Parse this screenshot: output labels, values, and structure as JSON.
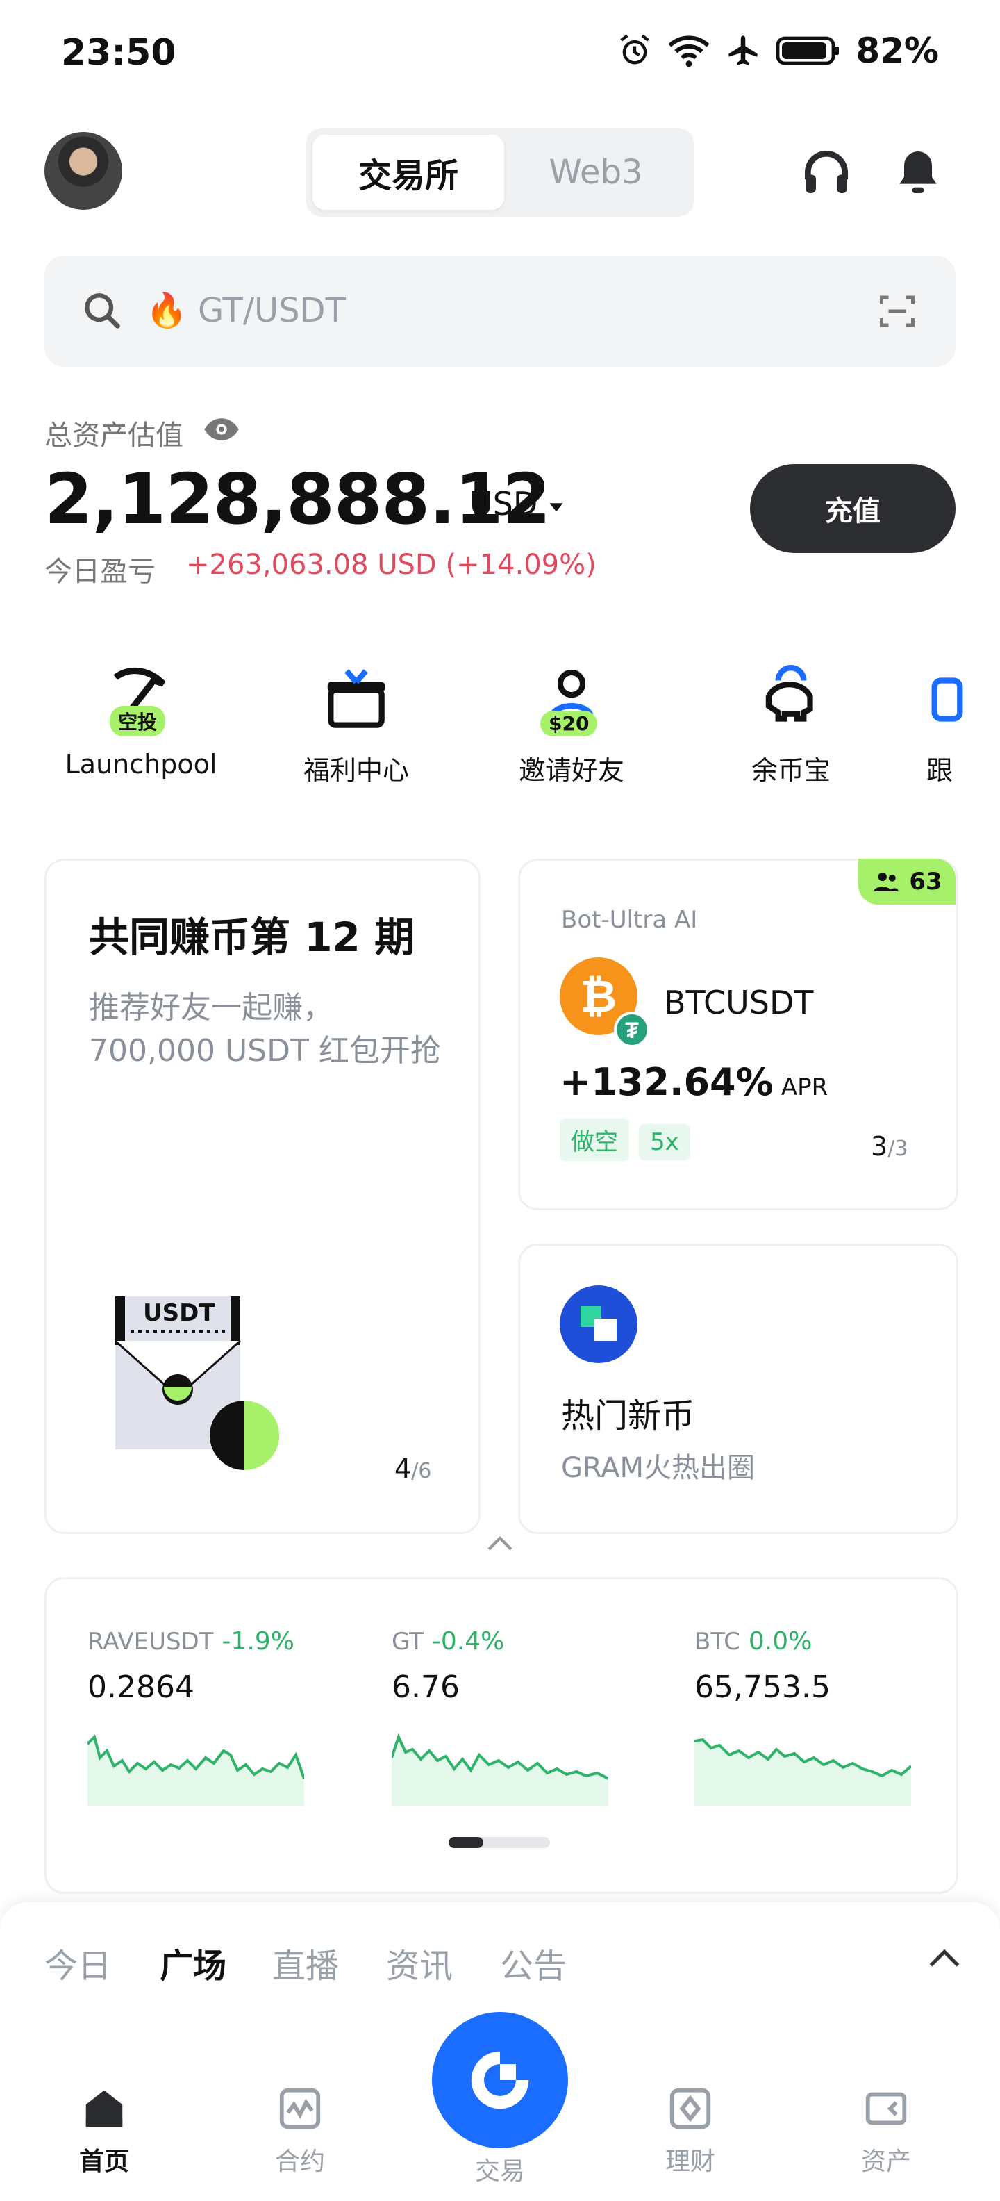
{
  "status_bar": {
    "time": "23:50",
    "battery": "82%"
  },
  "header": {
    "tabs": [
      {
        "label": "交易所",
        "active": true
      },
      {
        "label": "Web3",
        "active": false
      }
    ],
    "icons": [
      "headset-icon",
      "bell-icon"
    ]
  },
  "search": {
    "placeholder": "🔥 GT/USDT"
  },
  "totals": {
    "label": "总资产估值",
    "value": "2,128,888.12",
    "currency": "USD",
    "pnl_label": "今日盈亏",
    "pnl_value": "+263,063.08 USD",
    "pnl_percent": "(+14.09%)",
    "deposit_label": "充值"
  },
  "quick_actions": [
    {
      "label": "Launchpool",
      "badge": "空投"
    },
    {
      "label": "福利中心"
    },
    {
      "label": "邀请好友",
      "badge": "$20"
    },
    {
      "label": "余币宝"
    },
    {
      "label": "跟"
    }
  ],
  "promo_card": {
    "title": "共同赚币第 12 期",
    "subtitle_line1": "推荐好友一起赚，",
    "subtitle_line2": "700,000 USDT 红包开抢",
    "envelope_text": "USDT",
    "page_current": "4",
    "page_total": "/6"
  },
  "bot_card": {
    "badge_count": "63",
    "label": "Bot-Ultra AI",
    "pair": "BTCUSDT",
    "apr_value": "+132.64%",
    "apr_label": "APR",
    "tags": [
      "做空",
      "5x"
    ],
    "page_current": "3",
    "page_total": "/3"
  },
  "new_coins_card": {
    "title": "热门新币",
    "subtitle": "GRAM火热出圈"
  },
  "market": [
    {
      "name": "RAVEUSDT",
      "change": "-1.9%",
      "price": "0.2864"
    },
    {
      "name": "GT",
      "change": "-0.4%",
      "price": "6.76"
    },
    {
      "name": "BTC",
      "change": "0.0%",
      "price": "65,753.5"
    }
  ],
  "feed_tabs": [
    {
      "label": "今日",
      "active": false
    },
    {
      "label": "广场",
      "active": true
    },
    {
      "label": "直播",
      "active": false
    },
    {
      "label": "资讯",
      "active": false
    },
    {
      "label": "公告",
      "active": false
    }
  ],
  "bottom_nav": [
    {
      "label": "首页",
      "active": true
    },
    {
      "label": "合约",
      "active": false
    },
    {
      "label": "交易",
      "active": false
    },
    {
      "label": "理财",
      "active": false
    },
    {
      "label": "资产",
      "active": false
    }
  ],
  "colors": {
    "positive": "#2fb36a",
    "negative": "#e04a5e",
    "brand": "#1a6dff",
    "accent_green": "#a7f06a"
  }
}
